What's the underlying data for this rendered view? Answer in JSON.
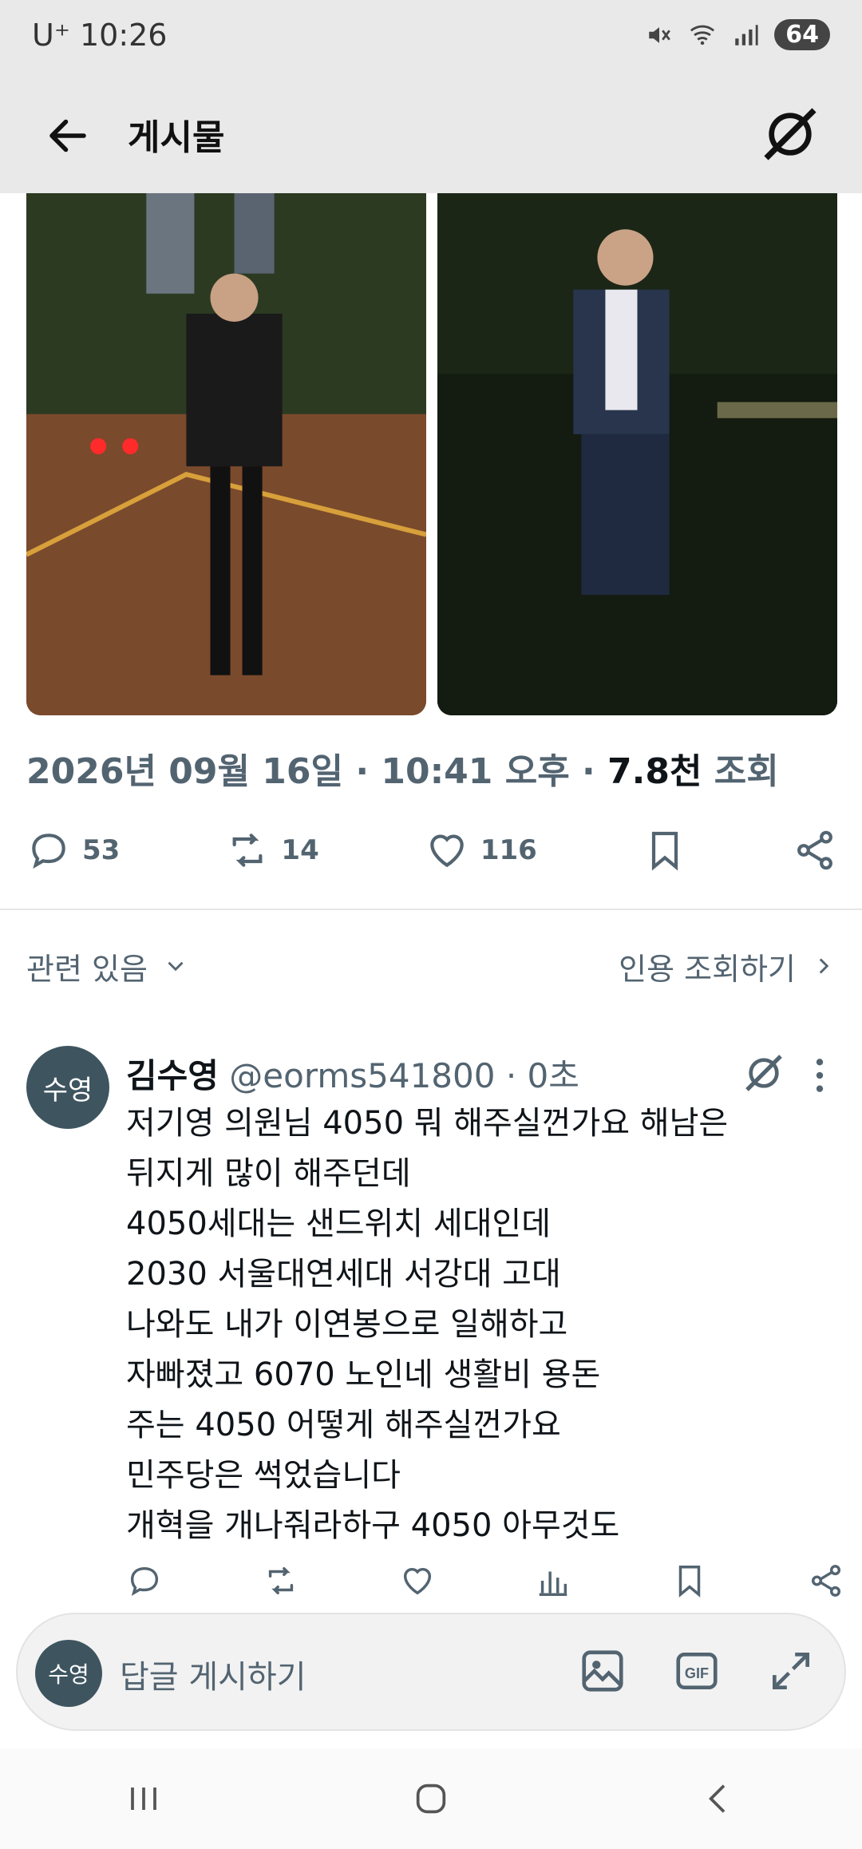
{
  "status_bar": {
    "time": "10:26",
    "carrier_prefix": "U⁺",
    "battery": "64"
  },
  "header": {
    "title": "게시물"
  },
  "post": {
    "timestamp": "2026년 09월 16일 · 10:41 오후 · ",
    "views_count": "7.8천",
    "views_label": " 조회",
    "stats": {
      "replies": "53",
      "reposts": "14",
      "likes": "116"
    }
  },
  "related": {
    "left_label": "관련 있음",
    "right_label": "인용 조회하기"
  },
  "reply": {
    "avatar_text": "수영",
    "name": "김수영",
    "handle": "@eorms541800",
    "time": " · 0초",
    "lines": [
      "저기영 의원님 4050  뭐 해주실껀가요 해남은",
      "뒤지게 많이 해주던데",
      "4050세대는 샌드위치 세대인데",
      "2030 서울대연세대 서강대 고대",
      "나와도 내가 이연봉으로 일해하고",
      "자빠졌고 6070 노인네 생활비 용돈",
      "주는 4050 어떻게 해주실껀가요",
      "민주당은 썩었습니다",
      "개혁을 개나줘라하구 4050 아무것도"
    ]
  },
  "composer": {
    "avatar_text": "수영",
    "placeholder": "답글 게시하기"
  },
  "icons": [
    "back-icon",
    "grok-icon",
    "reply-icon",
    "repost-icon",
    "like-icon",
    "bookmark-icon",
    "share-icon",
    "chevron-down-icon",
    "chevron-right-icon",
    "more-icon",
    "analytics-icon",
    "image-icon",
    "gif-icon",
    "expand-icon"
  ]
}
